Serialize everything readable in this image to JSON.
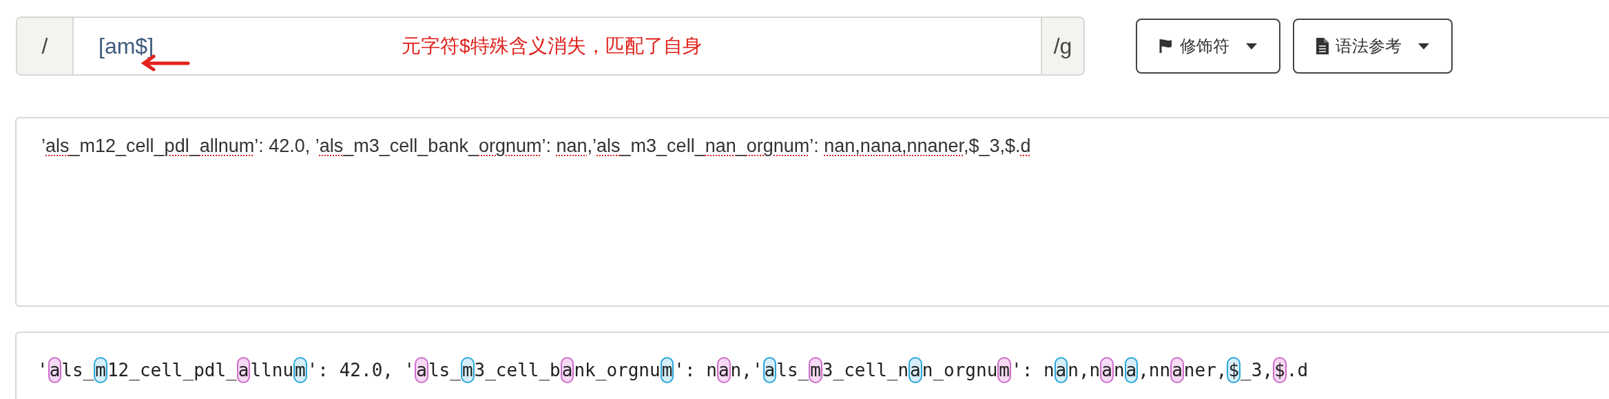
{
  "regex": {
    "open_delimiter": "/",
    "pattern": "[am$]",
    "flags": "/g",
    "annotation": "元字符$特殊含义消失，匹配了自身"
  },
  "buttons": [
    {
      "label": "修饰符",
      "kind": "flag"
    },
    {
      "label": "语法参考",
      "kind": "doc"
    }
  ],
  "input_text": [
    {
      "text": "’",
      "misspelled": false
    },
    {
      "text": "als",
      "misspelled": true
    },
    {
      "text": "_m12_cell_",
      "misspelled": false
    },
    {
      "text": "pdl",
      "misspelled": true
    },
    {
      "text": "_",
      "misspelled": false
    },
    {
      "text": "allnum",
      "misspelled": true
    },
    {
      "text": "’: 42.0, ’",
      "misspelled": false
    },
    {
      "text": "als",
      "misspelled": true
    },
    {
      "text": "_m3_cell_bank_",
      "misspelled": false
    },
    {
      "text": "orgnum",
      "misspelled": true
    },
    {
      "text": "’: ",
      "misspelled": false
    },
    {
      "text": "nan",
      "misspelled": true
    },
    {
      "text": ",’",
      "misspelled": false
    },
    {
      "text": "als",
      "misspelled": true
    },
    {
      "text": "_m3_cell_",
      "misspelled": false
    },
    {
      "text": "nan",
      "misspelled": true
    },
    {
      "text": "_",
      "misspelled": false
    },
    {
      "text": "orgnum",
      "misspelled": true
    },
    {
      "text": "’: ",
      "misspelled": false
    },
    {
      "text": "nan,nana,nnaner",
      "misspelled": true
    },
    {
      "text": ",$_3,$.",
      "misspelled": false
    },
    {
      "text": "d",
      "misspelled": true
    }
  ],
  "result_text": [
    {
      "text": "'",
      "match": false
    },
    {
      "text": "a",
      "match": true
    },
    {
      "text": "ls_",
      "match": false
    },
    {
      "text": "m",
      "match": true
    },
    {
      "text": "12_cell_pdl_",
      "match": false
    },
    {
      "text": "a",
      "match": true
    },
    {
      "text": "llnu",
      "match": false
    },
    {
      "text": "m",
      "match": true
    },
    {
      "text": "': 42.0, '",
      "match": false
    },
    {
      "text": "a",
      "match": true
    },
    {
      "text": "ls_",
      "match": false
    },
    {
      "text": "m",
      "match": true
    },
    {
      "text": "3_cell_b",
      "match": false
    },
    {
      "text": "a",
      "match": true
    },
    {
      "text": "nk_orgnu",
      "match": false
    },
    {
      "text": "m",
      "match": true
    },
    {
      "text": "': n",
      "match": false
    },
    {
      "text": "a",
      "match": true
    },
    {
      "text": "n,'",
      "match": false
    },
    {
      "text": "a",
      "match": true
    },
    {
      "text": "ls_",
      "match": false
    },
    {
      "text": "m",
      "match": true
    },
    {
      "text": "3_cell_n",
      "match": false
    },
    {
      "text": "a",
      "match": true
    },
    {
      "text": "n_orgnu",
      "match": false
    },
    {
      "text": "m",
      "match": true
    },
    {
      "text": "': n",
      "match": false
    },
    {
      "text": "a",
      "match": true
    },
    {
      "text": "n,n",
      "match": false
    },
    {
      "text": "a",
      "match": true
    },
    {
      "text": "n",
      "match": false
    },
    {
      "text": "a",
      "match": true
    },
    {
      "text": ",nn",
      "match": false
    },
    {
      "text": "a",
      "match": true
    },
    {
      "text": "ner,",
      "match": false
    },
    {
      "text": "$",
      "match": true
    },
    {
      "text": "_3,",
      "match": false
    },
    {
      "text": "$",
      "match": true
    },
    {
      "text": ".d",
      "match": false
    }
  ]
}
